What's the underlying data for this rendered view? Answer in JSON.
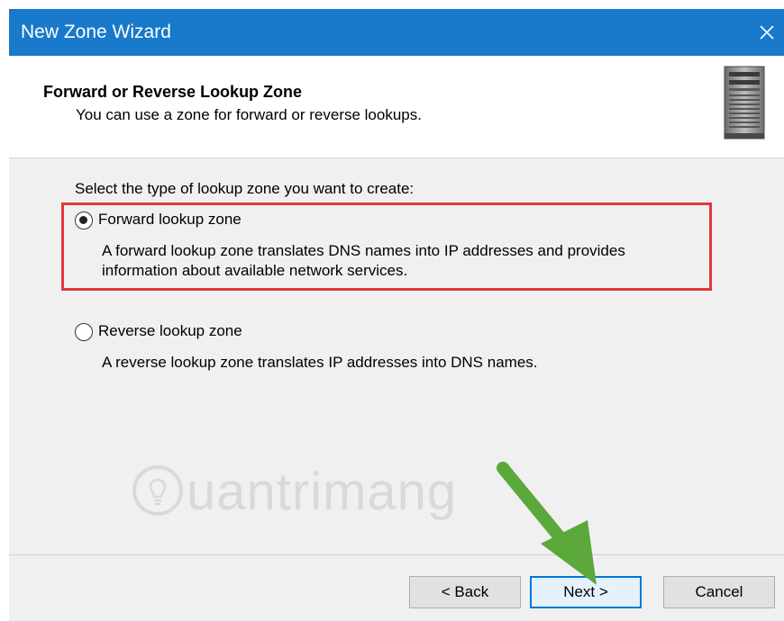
{
  "window": {
    "title": "New Zone Wizard"
  },
  "header": {
    "title": "Forward or Reverse Lookup Zone",
    "subtitle": "You can use a zone for forward or reverse lookups."
  },
  "prompt": "Select the type of lookup zone you want to create:",
  "options": [
    {
      "label": "Forward lookup zone",
      "selected": true,
      "description_lines": [
        "A forward lookup zone translates DNS names into IP addresses and provides",
        "information about available network services."
      ]
    },
    {
      "label": "Reverse lookup zone",
      "selected": false,
      "description_lines": [
        "A reverse lookup zone translates IP addresses into DNS names."
      ]
    }
  ],
  "watermark": "uantrimang",
  "buttons": {
    "back": "< Back",
    "next": "Next >",
    "cancel": "Cancel"
  },
  "colors": {
    "titlebar": "#1979ca",
    "highlight": "#e0393b",
    "arrow": "#5aa93a",
    "focus": "#0078d7"
  },
  "icons": {
    "close": "close-icon",
    "server": "server-icon",
    "watermark_logo": "lightbulb-icon"
  }
}
